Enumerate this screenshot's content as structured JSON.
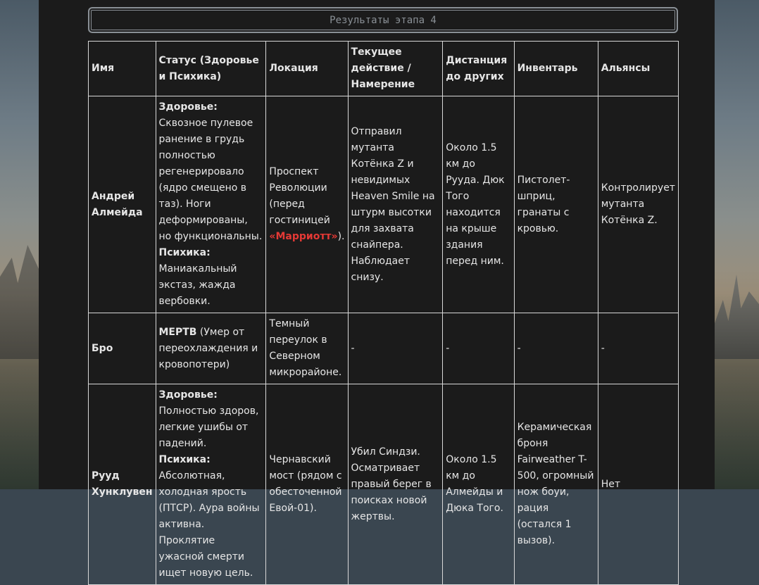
{
  "title": "Результаты этапа 4",
  "headers": [
    "Имя",
    "Статус (Здоровье и Психика)",
    "Локация",
    "Текущее действие / Намерение",
    "Дистанция до других",
    "Инвентарь",
    "Альянсы"
  ],
  "rows": [
    {
      "name": "Андрей Алмейда",
      "health_label": "Здоровье:",
      "health": " Сквозное пулевое ранение в грудь полностью регенерировало (ядро смещено в таз). Ноги деформированы, но функциональны.",
      "psyche_label": "Психика:",
      "psyche": " Маниакальный экстаз, жажда вербовки.",
      "location_pre": "Проспект Революции (перед гостиницей ",
      "location_hl": "«Марриотт»",
      "location_post": ").",
      "action": "Отправил мутанта Котёнка Z и невидимых Heaven Smile на штурм высотки для захвата снайпера. Наблюдает снизу.",
      "distance": "Около 1.5 км до Рууда. Дюк Того находится на крыше здания перед ним.",
      "inventory": "Пистолет-шприц, гранаты с кровью.",
      "alliances": "Контролирует мутанта Котёнка Z."
    },
    {
      "name": "Бро",
      "status_bold": "МЕРТВ",
      "status_rest": " (Умер от переохлаждения и кровопотери)",
      "location": "Темный переулок в Северном микрорайоне.",
      "action": "-",
      "distance": "-",
      "inventory": "-",
      "alliances": "-"
    },
    {
      "name": "Рууд Хунклувен",
      "health_label": "Здоровье:",
      "health": " Полностью здоров, легкие ушибы от падений.",
      "psyche_label": "Психика:",
      "psyche": " Абсолютная, холодная ярость (ПТСР). Аура войны активна. Проклятие ужасной смерти ищет новую цель.",
      "location": "Чернавский мост (рядом с обесточенной Евой-01).",
      "action": "Убил Синдзи. Осматривает правый берег в поисках новой жертвы.",
      "distance": "Около 1.5 км до Алмейды и Дюка Того.",
      "inventory": "Керамическая броня Fairweather T-500, огромный нож боуи, рация (остался 1 вызов).",
      "alliances": "Нет"
    }
  ]
}
